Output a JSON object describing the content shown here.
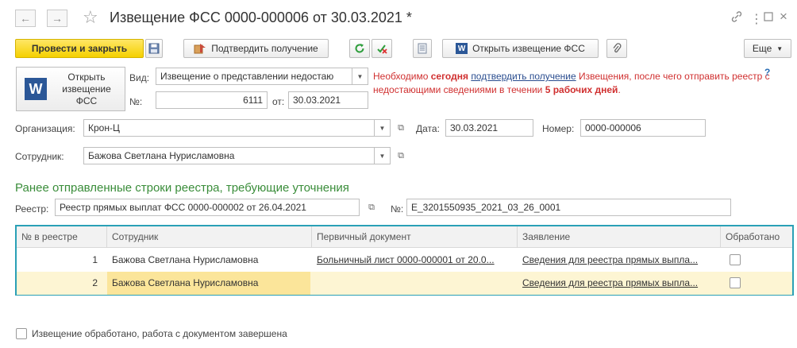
{
  "window": {
    "title": "Извещение ФСС 0000-000006 от 30.03.2021 *",
    "back_icon": "arrow-left-icon",
    "forward_icon": "arrow-right-icon",
    "star_icon": "star-icon",
    "link_icon": "link-icon",
    "menu_icon": "more-vert-icon",
    "maximize_icon": "maximize-icon",
    "close_icon": "close-icon"
  },
  "toolbar": {
    "post_close_label": "Провести и закрыть",
    "confirm_label": "Подтвердить получение",
    "open_notice_label": "Открыть извещение ФСС",
    "more_label": "Еще"
  },
  "open_button": {
    "line1": "Открыть",
    "line2": "извещение",
    "line3": "ФСС"
  },
  "form": {
    "vid_label": "Вид:",
    "vid_value": "Извещение о представлении недостаю",
    "num_label": "№:",
    "num_value": "6111",
    "from_label": "от:",
    "from_value": "30.03.2021",
    "org_label": "Организация:",
    "org_value": "Крон-Ц",
    "date_label": "Дата:",
    "date_value": "30.03.2021",
    "number_label": "Номер:",
    "number_value": "0000-000006",
    "employee_label": "Сотрудник:",
    "employee_value": "Бажова Светлана Нурисламовна"
  },
  "message": {
    "part1": "Необходимо ",
    "today": "сегодня",
    "link": "подтвердить получение",
    "part2": " Извещения, после чего отправить реестр с недостающими сведениями в течении ",
    "days": "5 рабочих дней",
    "part3": ".",
    "help": "?"
  },
  "section": {
    "title": "Ранее отправленные строки реестра, требующие уточнения",
    "registry_label": "Реестр:",
    "registry_value": "Реестр прямых выплат ФСС 0000-000002 от 26.04.2021",
    "no_label": "№:",
    "no_value": "E_3201550935_2021_03_26_0001"
  },
  "table": {
    "headers": [
      "№ в реестре",
      "Сотрудник",
      "Первичный документ",
      "Заявление",
      "Обработано"
    ],
    "rows": [
      {
        "num": "1",
        "employee": "Бажова Светлана Нурисламовна",
        "doc": "Больничный лист 0000-000001 от 20.0...",
        "application": "Сведения для реестра прямых выпла...",
        "processed": false
      },
      {
        "num": "2",
        "employee": "Бажова Светлана Нурисламовна",
        "doc": "",
        "application": "Сведения для реестра прямых выпла...",
        "processed": false
      }
    ]
  },
  "footer": {
    "done_label": "Извещение обработано, работа с документом завершена",
    "done_checked": false
  },
  "colors": {
    "primary_button": "#f5d000",
    "section_title": "#3a8d3a",
    "message": "#d03030",
    "table_border": "#2aa0b6",
    "selected_row": "#fdf5d3",
    "selected_cell": "#fbe59a"
  }
}
